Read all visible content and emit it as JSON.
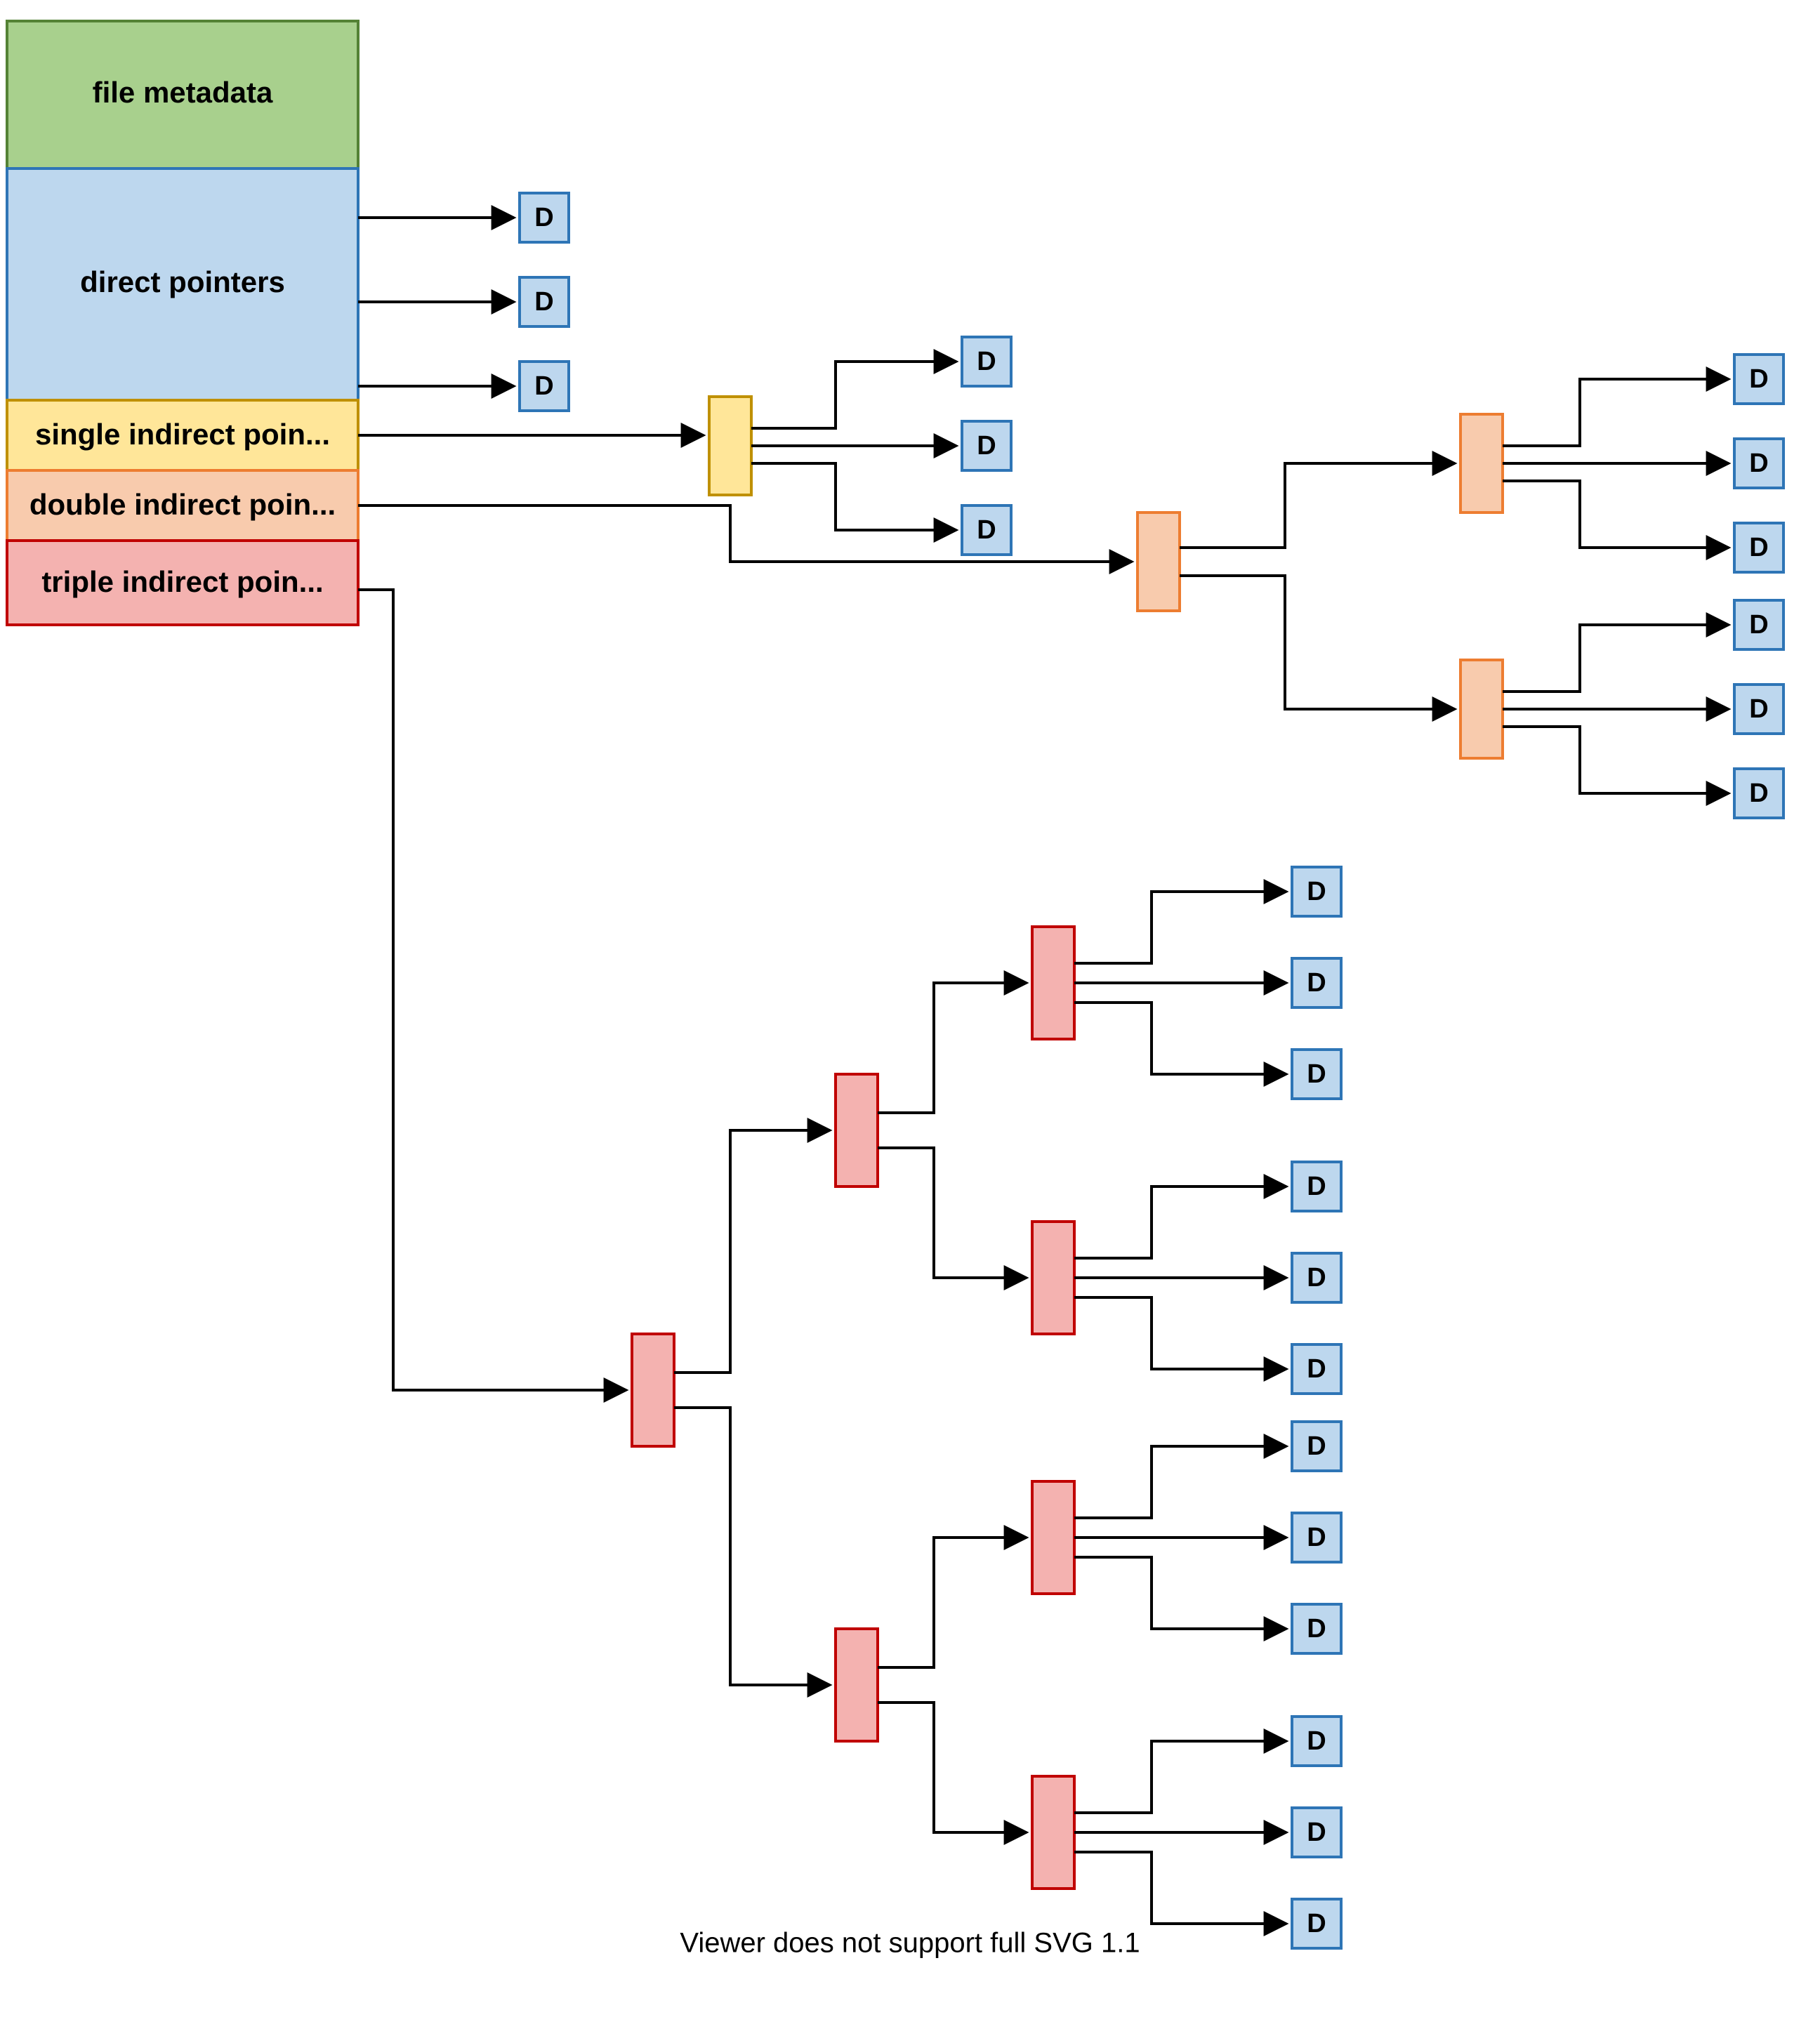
{
  "inode": {
    "metadata_label": "file metadata",
    "direct_label": "direct pointers",
    "single_label": "single indirect poin...",
    "double_label": "double indirect poin...",
    "triple_label": "triple indirect poin..."
  },
  "data_block_letter": "D",
  "footer_message": "Viewer does not support full SVG 1.1",
  "colors": {
    "metadata_fill": "#A8D08D",
    "metadata_stroke": "#548235",
    "direct_fill": "#BDD7EE",
    "direct_stroke": "#2E75B6",
    "single_fill": "#FFE699",
    "single_stroke": "#BF9000",
    "double_fill": "#F8CBAD",
    "double_stroke": "#ED7D31",
    "triple_fill": "#F4B2B0",
    "triple_stroke": "#C00000",
    "data_fill": "#BDD7EE",
    "data_stroke": "#2E75B6",
    "arrow": "#000000"
  },
  "diagram": {
    "type": "inode_block_pointer_tree",
    "description": "Unix-style inode with direct, single-, double-, and triple-indirect block pointers each ultimately referencing data blocks labeled D.",
    "direct_pointer_count_shown": 3,
    "single_indirect": {
      "fanout_shown": 3
    },
    "double_indirect": {
      "level1_fanout_shown": 2,
      "level2_fanout_shown": 3
    },
    "triple_indirect": {
      "level1_fanout_shown": 2,
      "level2_fanout_shown": 2,
      "level3_fanout_shown": 3
    }
  }
}
